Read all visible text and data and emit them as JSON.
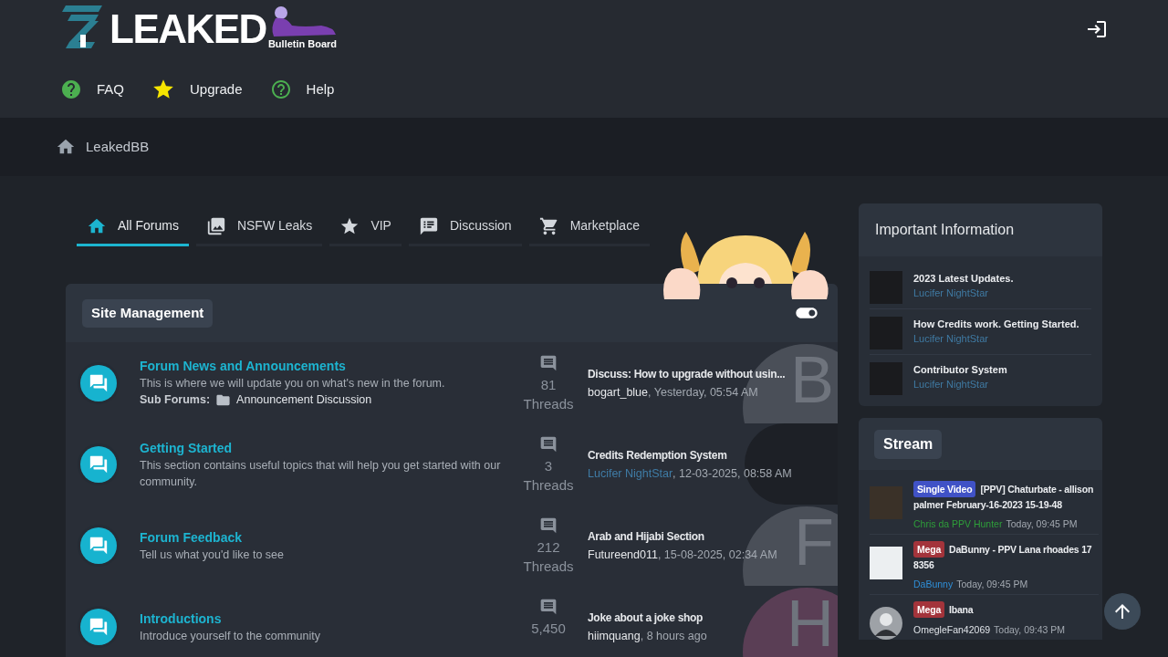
{
  "header": {
    "logo": {
      "wordmark": "LEAKED",
      "tagline": "Bulletin Board"
    },
    "nav": [
      {
        "kind": "faq",
        "label": "FAQ"
      },
      {
        "kind": "upgrade",
        "label": "Upgrade"
      },
      {
        "kind": "help",
        "label": "Help"
      }
    ]
  },
  "breadcrumb": {
    "label": "LeakedBB"
  },
  "tabs": [
    {
      "kind": "home",
      "label": "All Forums",
      "selected": true
    },
    {
      "kind": "images",
      "label": "NSFW Leaks",
      "selected": false
    },
    {
      "kind": "star",
      "label": "VIP",
      "selected": false
    },
    {
      "kind": "discussion",
      "label": "Discussion",
      "selected": false
    },
    {
      "kind": "cart",
      "label": "Marketplace",
      "selected": false
    }
  ],
  "category": {
    "title": "Site Management",
    "forums": [
      {
        "title": "Forum News and Announcements",
        "description": "This is where we will update you on what's new in the forum.",
        "sub_forums_label": "Sub Forums:",
        "sub_forums": [
          "Announcement Discussion"
        ],
        "threads": "81",
        "threads_label": "Threads",
        "last_post": {
          "title": "Discuss: How to upgrade without usin...",
          "author": {
            "name": "bogart_blue",
            "color": "#e6e8eb"
          },
          "time": ", Yesterday, 05:54 AM",
          "avatar": {
            "kind": "letter",
            "letter": "B",
            "color": "#4a4f58"
          }
        }
      },
      {
        "title": "Getting Started",
        "description": "This section contains useful topics that will help you get started with our community.",
        "threads": "3",
        "threads_label": "Threads",
        "last_post": {
          "title": "Credits Redemption System",
          "author": {
            "name": "Lucifer NightStar",
            "color": "#3f7ca6"
          },
          "time": ", 12-03-2025, 08:58 AM",
          "avatar": {
            "kind": "photo"
          }
        }
      },
      {
        "title": "Forum Feedback",
        "description": "Tell us what you'd like to see",
        "threads": "212",
        "threads_label": "Threads",
        "last_post": {
          "title": "Arab and Hijabi Section",
          "author": {
            "name": "Futureend011",
            "color": "#e6e8eb"
          },
          "time": ", 15-08-2025, 02:34 AM",
          "avatar": {
            "kind": "letter",
            "letter": "F",
            "color": "#4a4f58"
          }
        }
      },
      {
        "title": "Introductions",
        "description": "Introduce yourself to the community",
        "threads": "5,450",
        "last_post": {
          "title": "Joke about a joke shop",
          "author": {
            "name": "hiimquang",
            "color": "#e6e8eb"
          },
          "time": ", 8 hours ago",
          "avatar": {
            "kind": "letter",
            "letter": "H",
            "color": "#5a3e55"
          }
        }
      }
    ]
  },
  "sidebar": {
    "important": {
      "title": "Important Information",
      "items": [
        {
          "title": "2023 Latest Updates.",
          "author": "Lucifer NightStar"
        },
        {
          "title": "How Credits work. Getting Started.",
          "author": "Lucifer NightStar"
        },
        {
          "title": "Contributor System",
          "author": "Lucifer NightStar"
        }
      ]
    },
    "stream": {
      "title": "Stream",
      "items": [
        {
          "avatar": {
            "kind": "photo"
          },
          "badge": {
            "label": "Single Video",
            "color": "#4052c6"
          },
          "title": "[PPV] Chaturbate - allison palmer February-16-2023 15-19-48",
          "author": {
            "name": "Chris da PPV Hunter",
            "color": "#2e9e3a"
          },
          "time": "Today, 09:45 PM"
        },
        {
          "avatar": {
            "kind": "drawing"
          },
          "badge": {
            "label": "Mega",
            "color": "#a3343b"
          },
          "title": "DaBunny - PPV Lana rhoades 17 8356",
          "author": {
            "name": "DaBunny",
            "color": "#2f8fd8"
          },
          "time": "Today, 09:45 PM"
        },
        {
          "avatar": {
            "kind": "silhouette"
          },
          "badge": {
            "label": "Mega",
            "color": "#a3343b"
          },
          "title": "Ibana",
          "author": {
            "name": "OmegleFan42069",
            "color": "#dfe3e8"
          },
          "time": "Today, 09:43 PM"
        }
      ]
    }
  }
}
